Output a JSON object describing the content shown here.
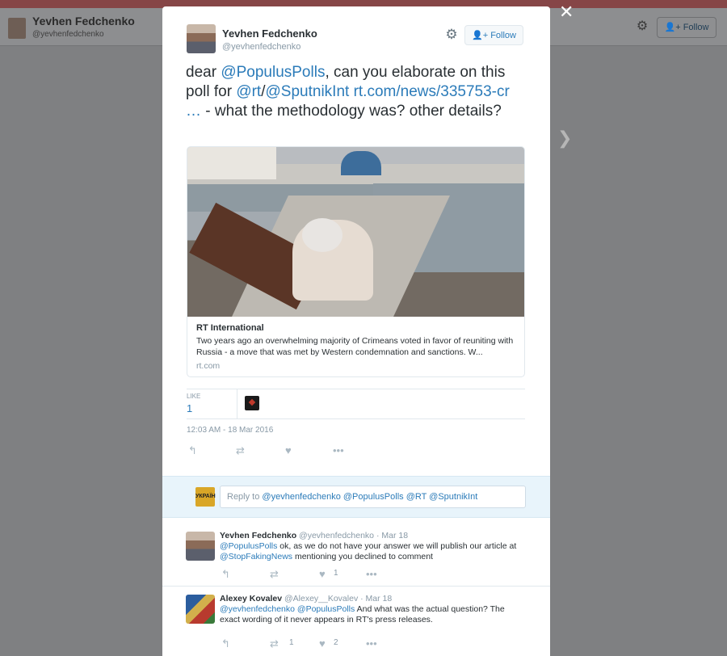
{
  "background": {
    "name": "Yevhen Fedchenko",
    "handle": "@yevhenfedchenko",
    "follow_label": "Follow"
  },
  "tweet": {
    "author_name": "Yevhen Fedchenko",
    "author_handle": "@yevhenfedchenko",
    "follow_label": "Follow",
    "text_parts": {
      "p1": "dear ",
      "m1": "@PopulusPolls",
      "p2": ", can you elaborate on this poll  for ",
      "m2": "@rt",
      "p3": "/",
      "m3": "@SputnikInt",
      "p4": " ",
      "url": "rt.com/news/335753-cr …",
      "p5": " - what the methodology was? other details?"
    },
    "card": {
      "title": "RT International",
      "description": "Two years ago an overwhelming majority of Crimeans voted in favor of reuniting with Russia - a move that was met by Western condemnation and sanctions. W...",
      "domain": "rt.com"
    },
    "stats": {
      "like_label": "LIKE",
      "like_count": "1"
    },
    "timestamp": "12:03 AM - 18 Mar 2016"
  },
  "reply_box": {
    "avatar_text": "УКРАЇН",
    "prefix": "Reply to ",
    "mentions": "@yevhenfedchenko @PopulusPolls @RT @SputnikInt"
  },
  "replies": [
    {
      "name": "Yevhen Fedchenko",
      "handle": "@yevhenfedchenko",
      "date": "Mar 18",
      "m1": "@PopulusPolls",
      "t1": " ok, as we do not have your answer we will publish our article at ",
      "m2": "@StopFakingNews",
      "t2": "  mentioning you declined to comment",
      "retweets": "",
      "likes": "1"
    },
    {
      "name": "Alexey Kovalev",
      "handle": "@Alexey__Kovalev",
      "date": "Mar 18",
      "m1": "@yevhenfedchenko",
      "sp": " ",
      "m2": "@PopulusPolls",
      "t1": " And what was the actual question? The exact wording of it never appears in RT's press releases.",
      "retweets": "1",
      "likes": "2"
    }
  ]
}
